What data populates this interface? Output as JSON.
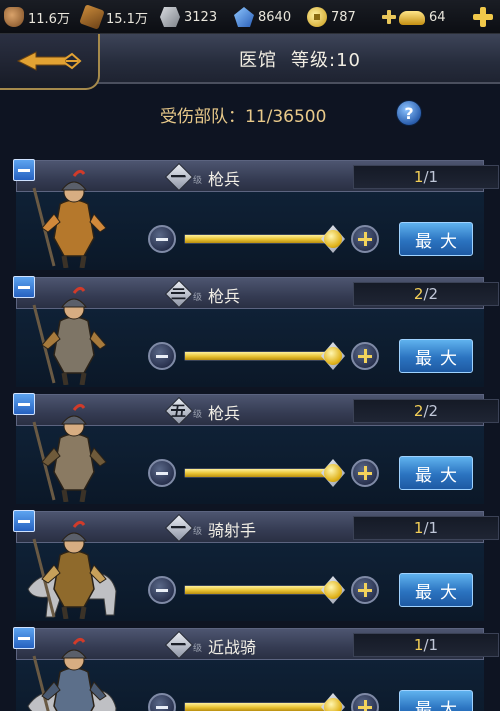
{
  "resources": [
    {
      "icon": "food-icon",
      "value": "11.6万"
    },
    {
      "icon": "wood-icon",
      "value": "15.1万"
    },
    {
      "icon": "stone-icon",
      "value": "3123"
    },
    {
      "icon": "iron-icon",
      "value": "8640"
    },
    {
      "icon": "coin-icon",
      "value": "787"
    },
    {
      "icon": "gold-ingot-icon",
      "value": "64"
    }
  ],
  "header": {
    "title": "医馆",
    "level_label": "等级:10"
  },
  "summary": {
    "label": "受伤部队：",
    "value": "11/36500"
  },
  "units": [
    {
      "rank": "一",
      "rank_suffix": "级",
      "name": "枪兵",
      "current": "1",
      "max": "1",
      "slider": 1.0,
      "max_label": "最大"
    },
    {
      "rank": "二",
      "rank_suffix": "级",
      "name": "枪兵",
      "current": "2",
      "max": "2",
      "slider": 1.0,
      "max_label": "最大"
    },
    {
      "rank": "五",
      "rank_suffix": "级",
      "name": "枪兵",
      "current": "2",
      "max": "2",
      "slider": 1.0,
      "max_label": "最大"
    },
    {
      "rank": "一",
      "rank_suffix": "级",
      "name": "骑射手",
      "current": "1",
      "max": "1",
      "slider": 1.0,
      "max_label": "最大"
    },
    {
      "rank": "一",
      "rank_suffix": "级",
      "name": "近战骑",
      "current": "1",
      "max": "1",
      "slider": 1.0,
      "max_label": "最大"
    }
  ],
  "colors": {
    "slider_fill": "#e9c232",
    "count_current": "#f3cf57",
    "max_button": "#2b73c0"
  }
}
